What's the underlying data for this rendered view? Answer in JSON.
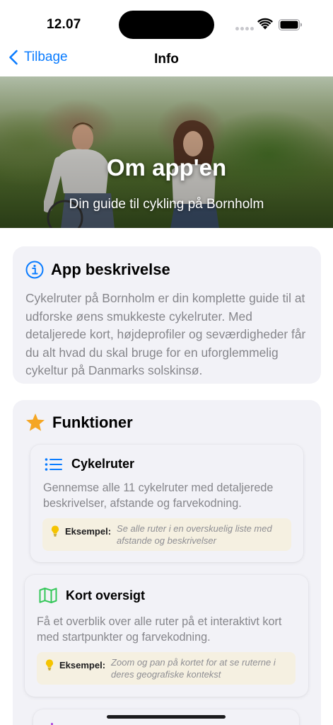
{
  "status_bar": {
    "time": "12.07"
  },
  "nav": {
    "back_label": "Tilbage",
    "title": "Info"
  },
  "hero": {
    "title": "Om app'en",
    "subtitle": "Din guide til cykling på Bornholm"
  },
  "about": {
    "title": "App beskrivelse",
    "text": "Cykelruter på Bornholm er din komplette guide til at udforske øens smukkeste cykelruter. Med detaljerede kort, højdeprofiler og seværdigheder får du alt hvad du skal bruge for en uforglemmelig cykeltur på Danmarks solskinsø.",
    "icon": "info-circle-icon",
    "icon_color": "#0a7cff"
  },
  "functions": {
    "title": "Funktioner",
    "icon": "star-icon",
    "icon_color": "#f5a623",
    "example_label": "Eksempel:",
    "items": [
      {
        "title": "Cykelruter",
        "icon": "list-icon",
        "icon_color": "#0a7cff",
        "text": "Gennemse alle 11 cykelruter med detaljerede beskrivelser, afstande og farvekodning.",
        "example": "Se alle ruter i en overskuelig liste med afstande og beskrivelser"
      },
      {
        "title": "Kort oversigt",
        "icon": "map-icon",
        "icon_color": "#34c759",
        "text": "Få et overblik over alle ruter på et interaktivt kort med startpunkter og farvekodning.",
        "example": "Zoom og pan på kortet for at se ruterne i deres geografiske kontekst"
      }
    ]
  },
  "colors": {
    "accent": "#0a7cff",
    "card_bg": "#f2f2f7",
    "example_bg": "#f5f0e1",
    "bulb": "#f5c400"
  }
}
